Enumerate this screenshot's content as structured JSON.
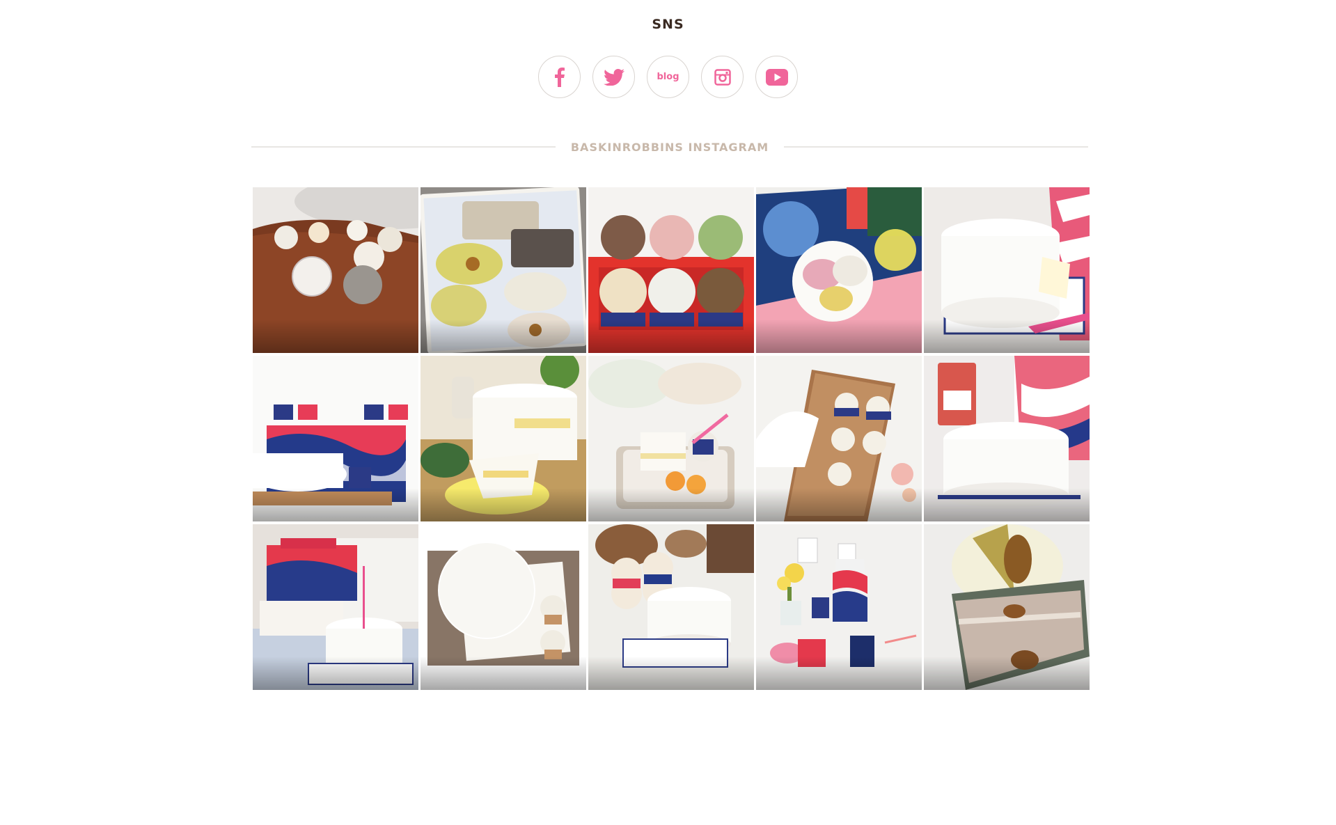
{
  "sns": {
    "title": "SNS",
    "buttons": [
      {
        "name": "facebook",
        "icon": "facebook-icon"
      },
      {
        "name": "twitter",
        "icon": "twitter-icon"
      },
      {
        "name": "blog",
        "icon": "blog-icon",
        "label": "blog"
      },
      {
        "name": "instagram",
        "icon": "instagram-icon"
      },
      {
        "name": "youtube",
        "icon": "youtube-icon"
      }
    ],
    "accent_color": "#f0659a"
  },
  "instagram": {
    "header": "BASKINROBBINS INSTAGRAM",
    "photo_count": 15
  },
  "colors": {
    "title": "#3a2a22",
    "header": "#c8b8aa",
    "brand_pink": "#f0659a",
    "brand_navy": "#2b3a86"
  }
}
